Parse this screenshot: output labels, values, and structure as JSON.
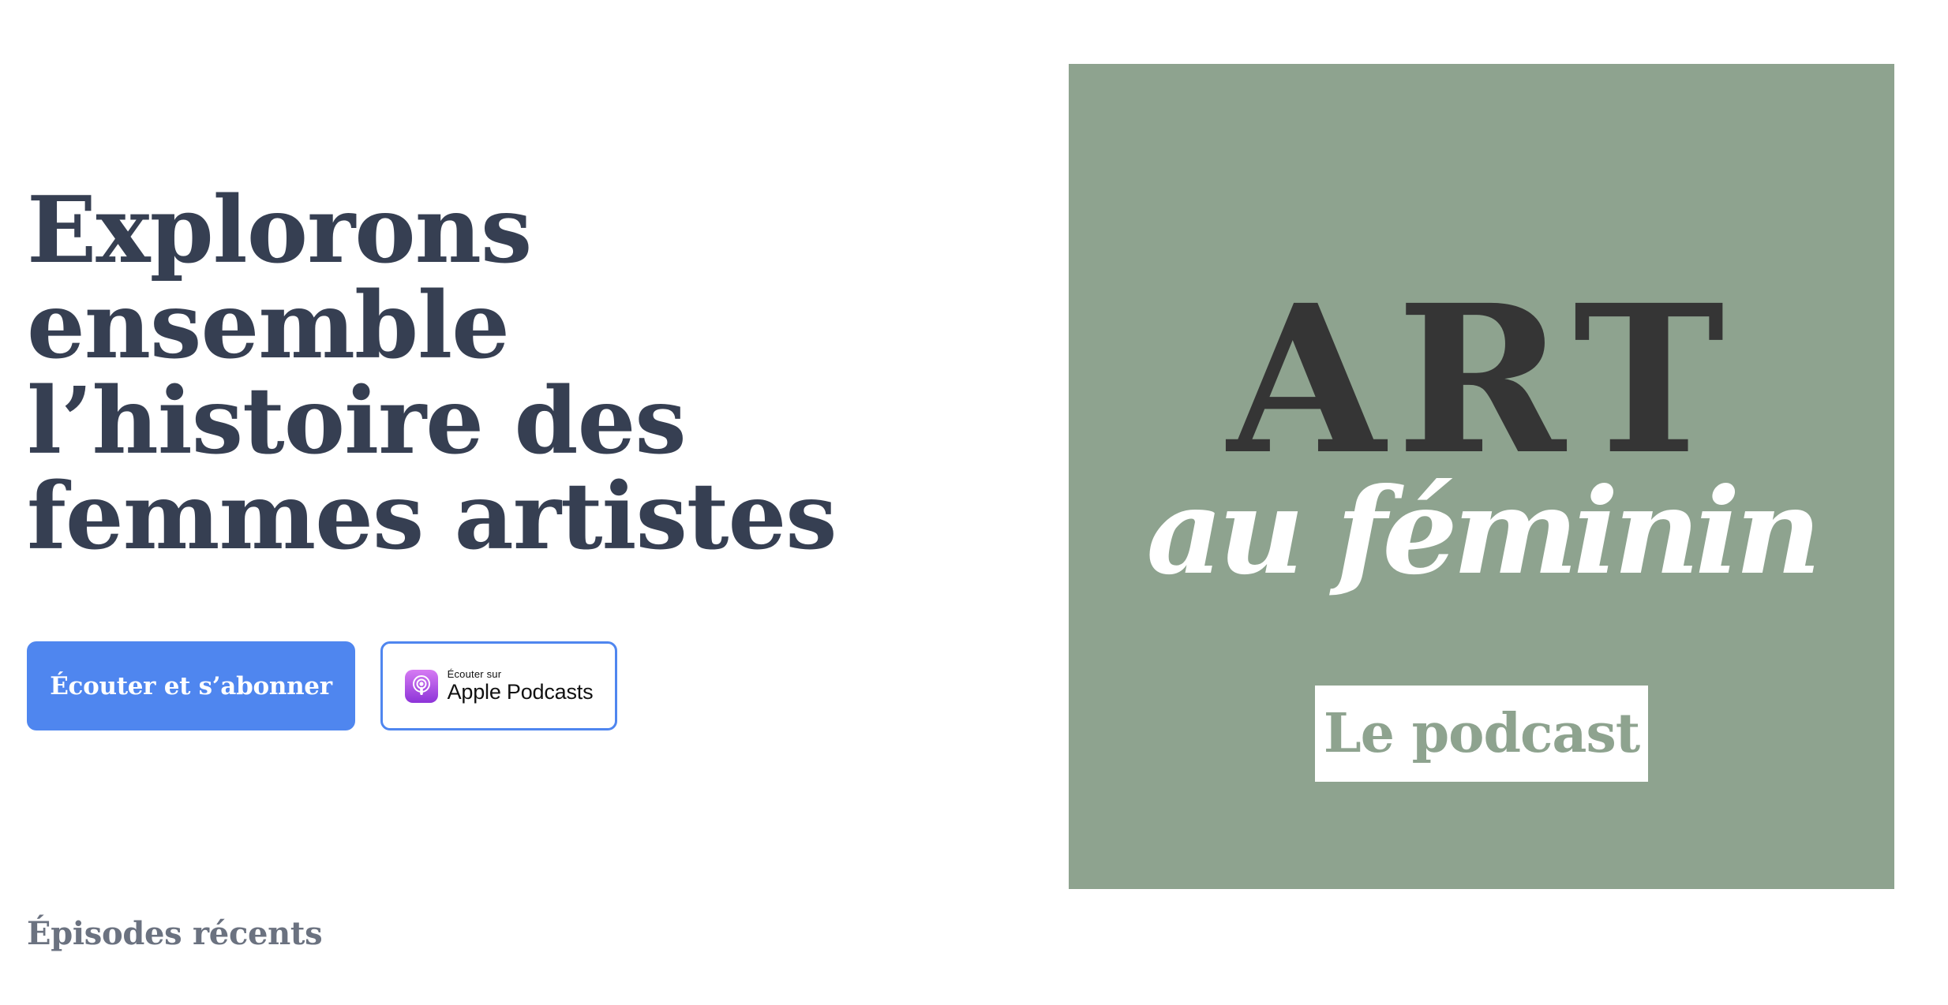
{
  "hero": {
    "title_lines": [
      "Explorons",
      "ensemble",
      "l’histoire des",
      "femmes artistes"
    ]
  },
  "buttons": {
    "subscribe_label": "Écouter et s’abonner",
    "apple_small_label": "Écouter sur",
    "apple_large_label": "Apple Podcasts",
    "apple_icon": "apple-podcasts-icon"
  },
  "sections": {
    "recent_heading": "Épisodes récents"
  },
  "cover": {
    "title": "ART",
    "subtitle": "au féminin",
    "tag": "Le podcast"
  },
  "colors": {
    "primary": "#4f86ef",
    "heading": "#363f52",
    "cover_background": "#8ea38f",
    "cover_title": "#353535",
    "muted": "#6b7280"
  }
}
